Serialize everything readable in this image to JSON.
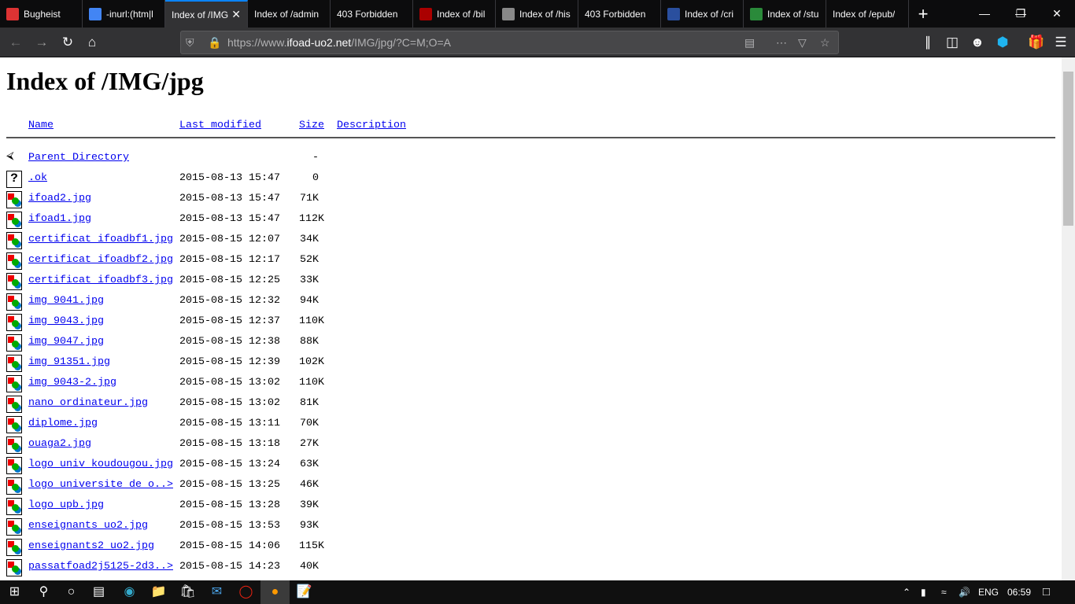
{
  "browser": {
    "tabs": [
      {
        "label": "Bugheist",
        "color": "#d33"
      },
      {
        "label": "-inurl:(htm|l",
        "color": "#4285f4"
      },
      {
        "label": "Index of /IMG",
        "color": "",
        "active": true
      },
      {
        "label": "Index of /admin",
        "color": ""
      },
      {
        "label": "403 Forbidden",
        "color": ""
      },
      {
        "label": "Index of /bil",
        "color": "#a00"
      },
      {
        "label": "Index of /his",
        "color": "#888"
      },
      {
        "label": "403 Forbidden",
        "color": ""
      },
      {
        "label": "Index of /cri",
        "color": "#2a4f9e"
      },
      {
        "label": "Index of /stu",
        "color": "#2a8a3a"
      },
      {
        "label": "Index of /epub/",
        "color": ""
      }
    ],
    "url_prefix": "https://www.",
    "url_domain": "ifoad-uo2.net",
    "url_path": "/IMG/jpg/?C=M;O=A",
    "accent": "#0a84ff"
  },
  "page": {
    "title": "Index of /IMG/jpg",
    "columns": {
      "name": "Name",
      "modified": "Last modified",
      "size": "Size",
      "description": "Description"
    },
    "parent": {
      "name": "Parent Directory",
      "size": "-"
    },
    "rows": [
      {
        "name": ".ok",
        "date": "2015-08-13 15:47",
        "size": "0",
        "type": "unknown"
      },
      {
        "name": "ifoad2.jpg",
        "date": "2015-08-13 15:47",
        "size": "71K"
      },
      {
        "name": "ifoad1.jpg",
        "date": "2015-08-13 15:47",
        "size": "112K"
      },
      {
        "name": "certificat_ifoadbf1.jpg",
        "date": "2015-08-15 12:07",
        "size": "34K"
      },
      {
        "name": "certificat_ifoadbf2.jpg",
        "date": "2015-08-15 12:17",
        "size": "52K"
      },
      {
        "name": "certificat_ifoadbf3.jpg",
        "date": "2015-08-15 12:25",
        "size": "33K"
      },
      {
        "name": "img_9041.jpg",
        "date": "2015-08-15 12:32",
        "size": "94K"
      },
      {
        "name": "img_9043.jpg",
        "date": "2015-08-15 12:37",
        "size": "110K"
      },
      {
        "name": "img_9047.jpg",
        "date": "2015-08-15 12:38",
        "size": "88K"
      },
      {
        "name": "img_91351.jpg",
        "date": "2015-08-15 12:39",
        "size": "102K"
      },
      {
        "name": "img_9043-2.jpg",
        "date": "2015-08-15 13:02",
        "size": "110K"
      },
      {
        "name": "nano_ordinateur.jpg",
        "date": "2015-08-15 13:02",
        "size": "81K"
      },
      {
        "name": "diplome.jpg",
        "date": "2015-08-15 13:11",
        "size": "70K"
      },
      {
        "name": "ouaga2.jpg",
        "date": "2015-08-15 13:18",
        "size": "27K"
      },
      {
        "name": "logo_univ_koudougou.jpg",
        "date": "2015-08-15 13:24",
        "size": "63K"
      },
      {
        "name": "logo_universite_de_o..>",
        "date": "2015-08-15 13:25",
        "size": "46K"
      },
      {
        "name": "logo_upb.jpg",
        "date": "2015-08-15 13:28",
        "size": "39K"
      },
      {
        "name": "enseignants_uo2.jpg",
        "date": "2015-08-15 13:53",
        "size": "93K"
      },
      {
        "name": "enseignants2_uo2.jpg",
        "date": "2015-08-15 14:06",
        "size": "115K"
      },
      {
        "name": "passatfoad2j5125-2d3..>",
        "date": "2015-08-15 14:23",
        "size": "40K"
      }
    ]
  },
  "taskbar": {
    "language": "ENG",
    "time": "06:59"
  }
}
